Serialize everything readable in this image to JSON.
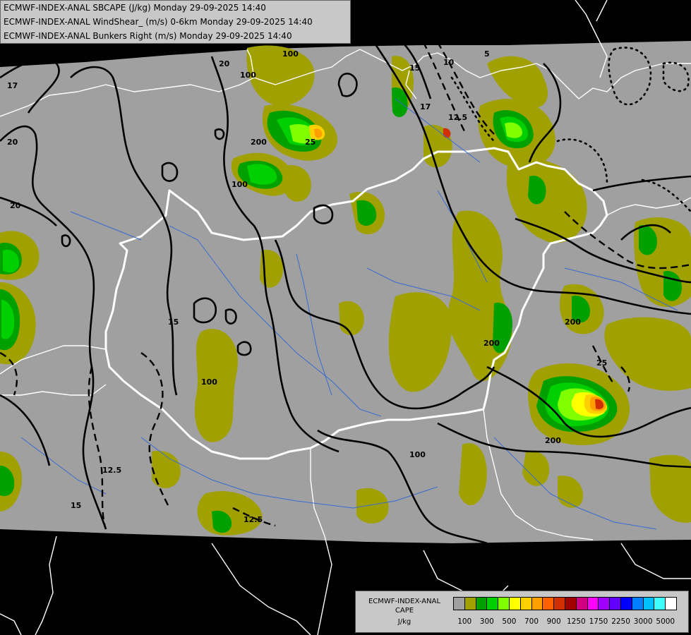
{
  "titles": {
    "line1": "ECMWF-INDEX-ANAL SBCAPE (J/kg) Monday 29-09-2025 14:40",
    "line2": "ECMWF-INDEX-ANAL WindShear_ (m/s) 0-6km Monday 29-09-2025 14:40",
    "line3": "ECMWF-INDEX-ANAL Bunkers Right (m/s) Monday 29-09-2025 14:40"
  },
  "legend": {
    "name1": "ECMWF-INDEX-ANAL",
    "name2": "CAPE",
    "unit": "J/kg",
    "colors": [
      "#a0a0a0",
      "#a0a000",
      "#00a000",
      "#00d000",
      "#80ff00",
      "#ffff00",
      "#ffd000",
      "#ffa000",
      "#ff6000",
      "#d03000",
      "#a00000",
      "#d00080",
      "#ff00ff",
      "#a000ff",
      "#6000ff",
      "#0000ff",
      "#0080ff",
      "#00c0ff",
      "#40ffff",
      "#ffffff"
    ],
    "ticks": [
      "100",
      "300",
      "500",
      "700",
      "900",
      "1250",
      "1750",
      "2250",
      "3000",
      "5000"
    ]
  },
  "map": {
    "background": "#a0a0a0",
    "outside": "#000000",
    "border_color": "#ffffff",
    "river_color": "#3a6ad0",
    "contour_labels": [
      "17",
      "20",
      "17",
      "20",
      "10",
      "12.5",
      "15",
      "17",
      "5",
      "15",
      "12.5",
      "15",
      "12.5",
      "25",
      "25",
      "20",
      "100",
      "100",
      "200",
      "100",
      "200",
      "100",
      "200",
      "100",
      "200"
    ]
  }
}
